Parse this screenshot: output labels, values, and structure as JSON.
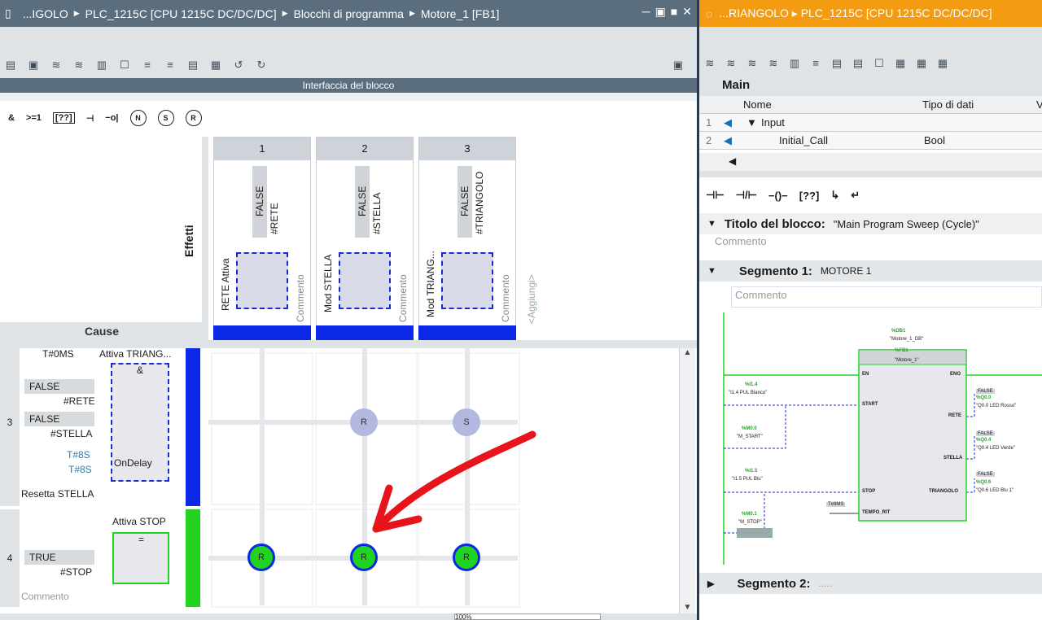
{
  "left_window": {
    "title_crumbs": [
      "...IGOLO",
      "PLC_1215C [CPU 1215C DC/DC/DC]",
      "Blocchi di programma",
      "Motore_1 [FB1]"
    ],
    "interface_bar": "Interfaccia del blocco",
    "logic_buttons": [
      "&",
      ">=1",
      "[??]",
      "⊣",
      "−o|",
      "N",
      "S",
      "R"
    ],
    "effects_label": "Effetti",
    "cause_label": "Cause",
    "effect_columns": [
      {
        "num": "1",
        "value": "FALSE",
        "var": "#RETE",
        "name": "RETE Attiva",
        "comment": "Commento"
      },
      {
        "num": "2",
        "value": "FALSE",
        "var": "#STELLA",
        "name": "Mod STELLA",
        "comment": "Commento"
      },
      {
        "num": "3",
        "value": "FALSE",
        "var": "#TRIANGOLO",
        "name": "Mod TRIANG...",
        "comment": "Commento"
      }
    ],
    "add_label": "<Aggiungi>",
    "box_eq": "=",
    "rows": [
      {
        "num": "3",
        "top_time": "T#0MS",
        "top_name": "Attiva TRIANG...",
        "and": "&",
        "in1_val": "FALSE",
        "in1_var": "#RETE",
        "in2_val": "FALSE",
        "in2_var": "#STELLA",
        "time1": "T#8S",
        "time2": "T#8S",
        "ondelay": "OnDelay",
        "comment": "Resetta STELLA",
        "nodes": [
          "R",
          "S"
        ]
      },
      {
        "num": "4",
        "top_name": "Attiva STOP",
        "eq": "=",
        "in_val": "TRUE",
        "in_var": "#STOP",
        "comment": "Commento",
        "nodes": [
          "R",
          "R",
          "R"
        ]
      }
    ],
    "zoom": "100%"
  },
  "right_window": {
    "title": "...RIANGOLO ▸ PLC_1215C [CPU 1215C DC/DC/DC]",
    "main": "Main",
    "columns": [
      "Nome",
      "Tipo di dati",
      "V"
    ],
    "interface_rows": [
      {
        "num": "1",
        "name": "Input",
        "type": ""
      },
      {
        "num": "2",
        "name": "Initial_Call",
        "type": "Bool"
      }
    ],
    "block_title_label": "Titolo del blocco:",
    "block_title": "\"Main Program Sweep (Cycle)\"",
    "comment": "Commento",
    "seg1_label": "Segmento 1:",
    "seg1_name": "MOTORE 1",
    "seg2_label": "Segmento 2:",
    "seg2_name": ".....",
    "fb": {
      "db_addr": "%DB1",
      "db_name": "\"Motore_1_DB\"",
      "fb_addr": "%FB1",
      "fb_name": "\"Motore_1\"",
      "en": "EN",
      "eno": "ENO",
      "start": "START",
      "stop": "STOP",
      "tempo": "TEMPO_RIT",
      "rete": "RETE",
      "stella": "STELLA",
      "triangolo": "TRIANGOLO",
      "in1_addr": "%I1.4",
      "in1_name": "\"I1.4 PUL Bianco\"",
      "in2_addr": "%M0.0",
      "in2_name": "\"M_START\"",
      "in3_addr": "%I1.5",
      "in3_name": "\"I1.5 PUL Blu\"",
      "in4_addr": "%M0.1",
      "in4_name": "\"M_STOP\"",
      "tempo_val": "T#8MS",
      "out1_state": "FALSE",
      "out1_addr": "%Q0.0",
      "out1_name": "\"Q0.0 LED Rosso\"",
      "out2_state": "FALSE",
      "out2_addr": "%Q0.4",
      "out2_name": "\"Q0.4 LED Verde\"",
      "out3_state": "FALSE",
      "out3_addr": "%Q0.6",
      "out3_name": "\"Q0.6 LED Blu 1\""
    }
  },
  "colors": {
    "accent_orange": "#f39c12",
    "blue": "#0a28e6",
    "green": "#22d322",
    "red": "#e8141b"
  }
}
